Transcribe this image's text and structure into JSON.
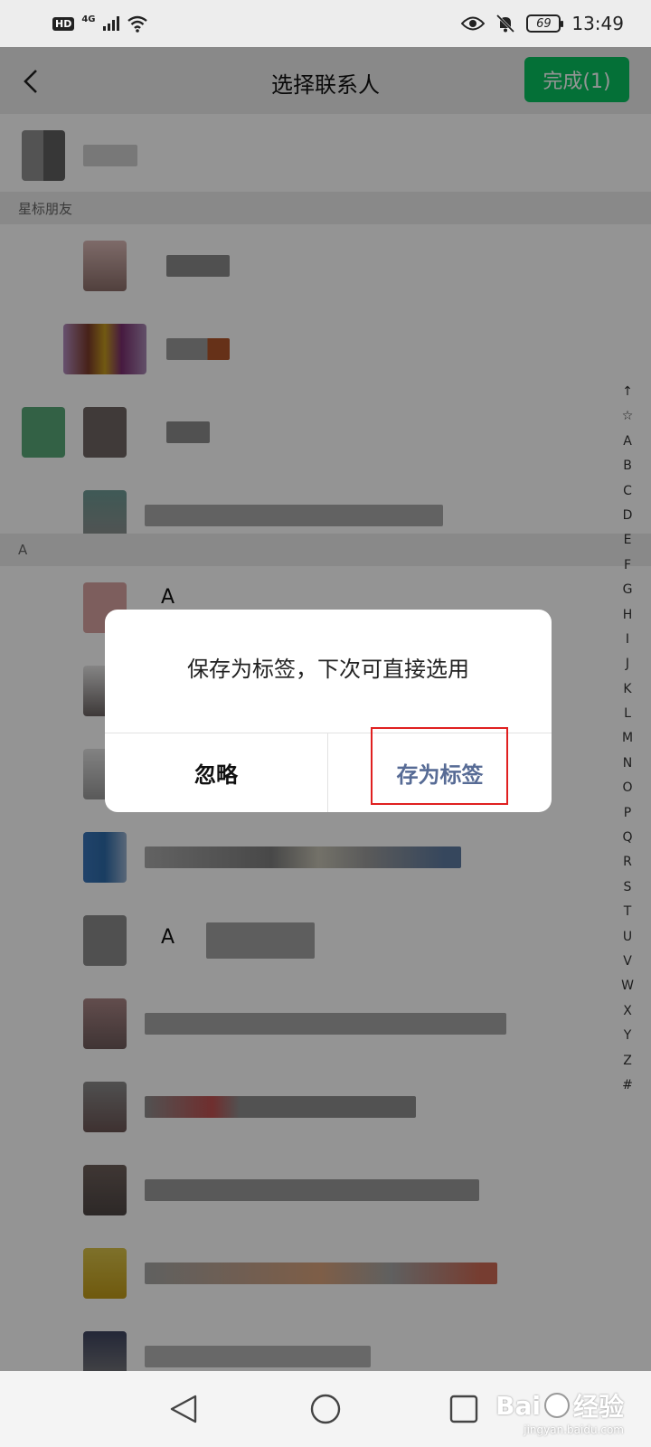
{
  "status_bar": {
    "hd": "HD",
    "network": "4G",
    "battery": "69",
    "time": "13:49"
  },
  "header": {
    "title": "选择联系人",
    "done_label": "完成(1)",
    "accent": "#07c160"
  },
  "sections": {
    "starred": "星标朋友",
    "a": "A"
  },
  "contacts": {
    "partial_name_1": "A",
    "partial_name_2": "A"
  },
  "index_bar": [
    "↑",
    "☆",
    "A",
    "B",
    "C",
    "D",
    "E",
    "F",
    "G",
    "H",
    "I",
    "J",
    "K",
    "L",
    "M",
    "N",
    "O",
    "P",
    "Q",
    "R",
    "S",
    "T",
    "U",
    "V",
    "W",
    "X",
    "Y",
    "Z",
    "#"
  ],
  "dialog": {
    "message": "保存为标签，下次可直接选用",
    "ignore_label": "忽略",
    "save_label": "存为标签",
    "save_color": "#576b95"
  },
  "watermark": {
    "brand": "Bai",
    "brand_cn": "经验",
    "url": "jingyan.baidu.com"
  }
}
